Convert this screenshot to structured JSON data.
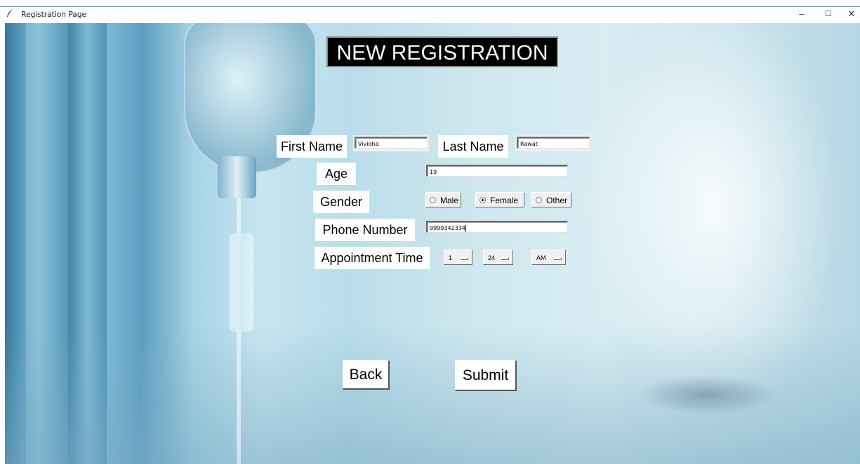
{
  "window": {
    "title": "Registration Page",
    "minimize_glyph": "–",
    "maximize_glyph": "☐",
    "close_glyph": "✕"
  },
  "form": {
    "heading": "NEW REGISTRATION",
    "first_name": {
      "label": "First Name",
      "value": "Vividha"
    },
    "last_name": {
      "label": "Last Name",
      "value": "Rawat"
    },
    "age": {
      "label": "Age",
      "value": "19"
    },
    "gender": {
      "label": "Gender",
      "options": [
        "Male",
        "Female",
        "Other"
      ],
      "selected": "Female"
    },
    "phone": {
      "label": "Phone Number",
      "value": "9999342334"
    },
    "appointment": {
      "label": "Appointment Time",
      "hour": "1",
      "minute": "24",
      "period": "AM"
    }
  },
  "buttons": {
    "back": "Back",
    "submit": "Submit"
  },
  "icons": {
    "app": "feather-icon"
  }
}
